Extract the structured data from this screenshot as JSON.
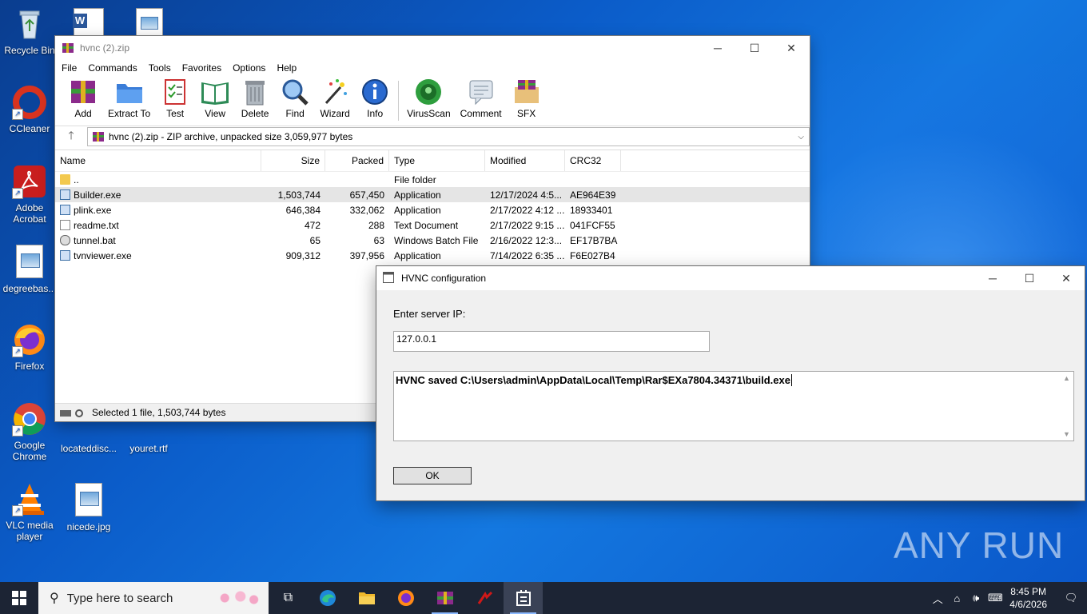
{
  "desktop": {
    "icons": [
      {
        "label": "Recycle Bin"
      },
      {
        "label": "CCleaner"
      },
      {
        "label": "Adobe Acrobat"
      },
      {
        "label": "degreebas..."
      },
      {
        "label": "Firefox"
      },
      {
        "label": "Google Chrome"
      },
      {
        "label": "VLC media player"
      },
      {
        "label": "locateddisc..."
      },
      {
        "label": "youret.rtf"
      },
      {
        "label": "nicede.jpg"
      }
    ]
  },
  "winrar": {
    "title": "hvnc (2).zip",
    "menu": [
      "File",
      "Commands",
      "Tools",
      "Favorites",
      "Options",
      "Help"
    ],
    "toolbar": [
      "Add",
      "Extract To",
      "Test",
      "View",
      "Delete",
      "Find",
      "Wizard",
      "Info",
      "VirusScan",
      "Comment",
      "SFX"
    ],
    "address": "hvnc (2).zip - ZIP archive, unpacked size 3,059,977 bytes",
    "columns": [
      "Name",
      "Size",
      "Packed",
      "Type",
      "Modified",
      "CRC32"
    ],
    "rows": [
      {
        "name": "..",
        "size": "",
        "packed": "",
        "type": "File folder",
        "modified": "",
        "crc": ""
      },
      {
        "name": "Builder.exe",
        "size": "1,503,744",
        "packed": "657,450",
        "type": "Application",
        "modified": "12/17/2024 4:5...",
        "crc": "AE964E39"
      },
      {
        "name": "plink.exe",
        "size": "646,384",
        "packed": "332,062",
        "type": "Application",
        "modified": "2/17/2022 4:12 ...",
        "crc": "18933401"
      },
      {
        "name": "readme.txt",
        "size": "472",
        "packed": "288",
        "type": "Text Document",
        "modified": "2/17/2022 9:15 ...",
        "crc": "041FCF55"
      },
      {
        "name": "tunnel.bat",
        "size": "65",
        "packed": "63",
        "type": "Windows Batch File",
        "modified": "2/16/2022 12:3...",
        "crc": "EF17B7BA"
      },
      {
        "name": "tvnviewer.exe",
        "size": "909,312",
        "packed": "397,956",
        "type": "Application",
        "modified": "7/14/2022 6:35 ...",
        "crc": "F6E027B4"
      }
    ],
    "status": "Selected 1 file, 1,503,744 bytes"
  },
  "dialog": {
    "title": "HVNC configuration",
    "label": "Enter server IP:",
    "ip_value": "127.0.0.1",
    "output": "HVNC saved C:\\Users\\admin\\AppData\\Local\\Temp\\Rar$EXa7804.34371\\build.exe",
    "ok": "OK"
  },
  "watermark": "ANY RUN",
  "taskbar": {
    "search_placeholder": "Type here to search",
    "time": "8:45 PM",
    "date": "4/6/2026"
  }
}
